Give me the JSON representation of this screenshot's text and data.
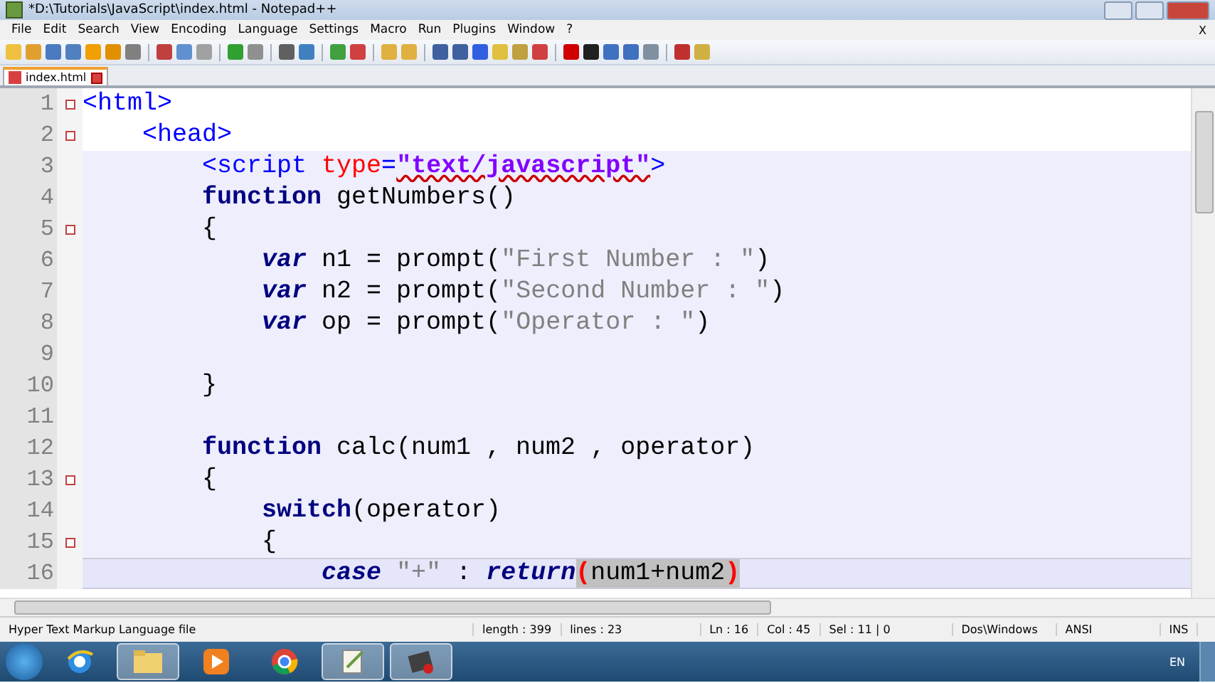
{
  "window": {
    "title": "*D:\\Tutorials\\JavaScript\\index.html - Notepad++"
  },
  "menu": [
    "File",
    "Edit",
    "Search",
    "View",
    "Encoding",
    "Language",
    "Settings",
    "Macro",
    "Run",
    "Plugins",
    "Window",
    "?"
  ],
  "menu_close": "X",
  "tabs": [
    {
      "label": "index.html",
      "selected": true
    }
  ],
  "editor": {
    "lines": [
      {
        "number": "1",
        "fold": true,
        "script_block": false,
        "current": false,
        "tokens": [
          {
            "kind": "tag",
            "text": "<html>"
          }
        ]
      },
      {
        "number": "2",
        "fold": true,
        "script_block": false,
        "current": false,
        "tokens": [
          {
            "kind": "tag",
            "text": "    <head>"
          }
        ]
      },
      {
        "number": "3",
        "fold": false,
        "script_block": true,
        "current": false,
        "tokens": [
          {
            "kind": "tag",
            "text": "        <script "
          },
          {
            "kind": "attr",
            "text": "type"
          },
          {
            "kind": "tag",
            "text": "="
          },
          {
            "kind": "attrval",
            "text": "\"text/javascript\""
          },
          {
            "kind": "tag",
            "text": ">"
          }
        ]
      },
      {
        "number": "4",
        "fold": false,
        "script_block": true,
        "current": false,
        "tokens": [
          {
            "kind": "keyword",
            "text": "        function"
          },
          {
            "kind": "plain",
            "text": " getNumbers()"
          }
        ]
      },
      {
        "number": "5",
        "fold": true,
        "script_block": true,
        "current": false,
        "tokens": [
          {
            "kind": "plain",
            "text": "        {"
          }
        ]
      },
      {
        "number": "6",
        "fold": false,
        "script_block": true,
        "current": false,
        "tokens": [
          {
            "kind": "keyword-italic",
            "text": "            var"
          },
          {
            "kind": "plain",
            "text": " n1 = prompt("
          },
          {
            "kind": "string",
            "text": "\"First Number : \""
          },
          {
            "kind": "plain",
            "text": ")"
          }
        ]
      },
      {
        "number": "7",
        "fold": false,
        "script_block": true,
        "current": false,
        "tokens": [
          {
            "kind": "keyword-italic",
            "text": "            var"
          },
          {
            "kind": "plain",
            "text": " n2 = prompt("
          },
          {
            "kind": "string",
            "text": "\"Second Number : \""
          },
          {
            "kind": "plain",
            "text": ")"
          }
        ]
      },
      {
        "number": "8",
        "fold": false,
        "script_block": true,
        "current": false,
        "tokens": [
          {
            "kind": "keyword-italic",
            "text": "            var"
          },
          {
            "kind": "plain",
            "text": " op = prompt("
          },
          {
            "kind": "string",
            "text": "\"Operator : \""
          },
          {
            "kind": "plain",
            "text": ")"
          }
        ]
      },
      {
        "number": "9",
        "fold": false,
        "script_block": true,
        "current": false
      },
      {
        "number": "10",
        "fold": false,
        "script_block": true,
        "current": false,
        "tokens": [
          {
            "kind": "plain",
            "text": "        }"
          }
        ]
      },
      {
        "number": "11",
        "fold": false,
        "script_block": true,
        "current": false
      },
      {
        "number": "12",
        "fold": false,
        "script_block": true,
        "current": false,
        "tokens": [
          {
            "kind": "keyword",
            "text": "        function"
          },
          {
            "kind": "plain",
            "text": " calc(num1 , num2 , operator)"
          }
        ]
      },
      {
        "number": "13",
        "fold": true,
        "script_block": true,
        "current": false,
        "tokens": [
          {
            "kind": "plain",
            "text": "        {"
          }
        ]
      },
      {
        "number": "14",
        "fold": false,
        "script_block": true,
        "current": false,
        "tokens": [
          {
            "kind": "keyword",
            "text": "            switch"
          },
          {
            "kind": "plain",
            "text": "(operator)"
          }
        ]
      },
      {
        "number": "15",
        "fold": true,
        "script_block": true,
        "current": false,
        "tokens": [
          {
            "kind": "plain",
            "text": "            {"
          }
        ]
      },
      {
        "number": "16",
        "fold": false,
        "script_block": true,
        "current": true,
        "tokens": [
          {
            "kind": "keyword-italic",
            "text": "                case "
          },
          {
            "kind": "string",
            "text": "\"+\""
          },
          {
            "kind": "plain",
            "text": " : "
          },
          {
            "kind": "keyword-italic",
            "text": "return"
          },
          {
            "kind": "brace",
            "text": "("
          },
          {
            "kind": "selected",
            "text": "num1+num2"
          },
          {
            "kind": "brace",
            "text": ")"
          }
        ]
      }
    ]
  },
  "status_bar": {
    "file_type": "Hyper Text Markup Language file",
    "length": "length : 399",
    "lines": "lines : 23",
    "position": "Ln : 16",
    "column": "Col : 45",
    "selection": "Sel : 11 | 0",
    "eol": "Dos\\Windows",
    "encoding": "ANSI",
    "mode": "INS"
  },
  "taskbar": {
    "apps": [
      {
        "kind": "ie",
        "open": false
      },
      {
        "kind": "folder",
        "open": true
      },
      {
        "kind": "media",
        "open": false
      },
      {
        "kind": "chrome",
        "open": false
      },
      {
        "kind": "notepad",
        "open": true
      },
      {
        "kind": "terminal",
        "open": true
      }
    ],
    "language": "EN"
  }
}
